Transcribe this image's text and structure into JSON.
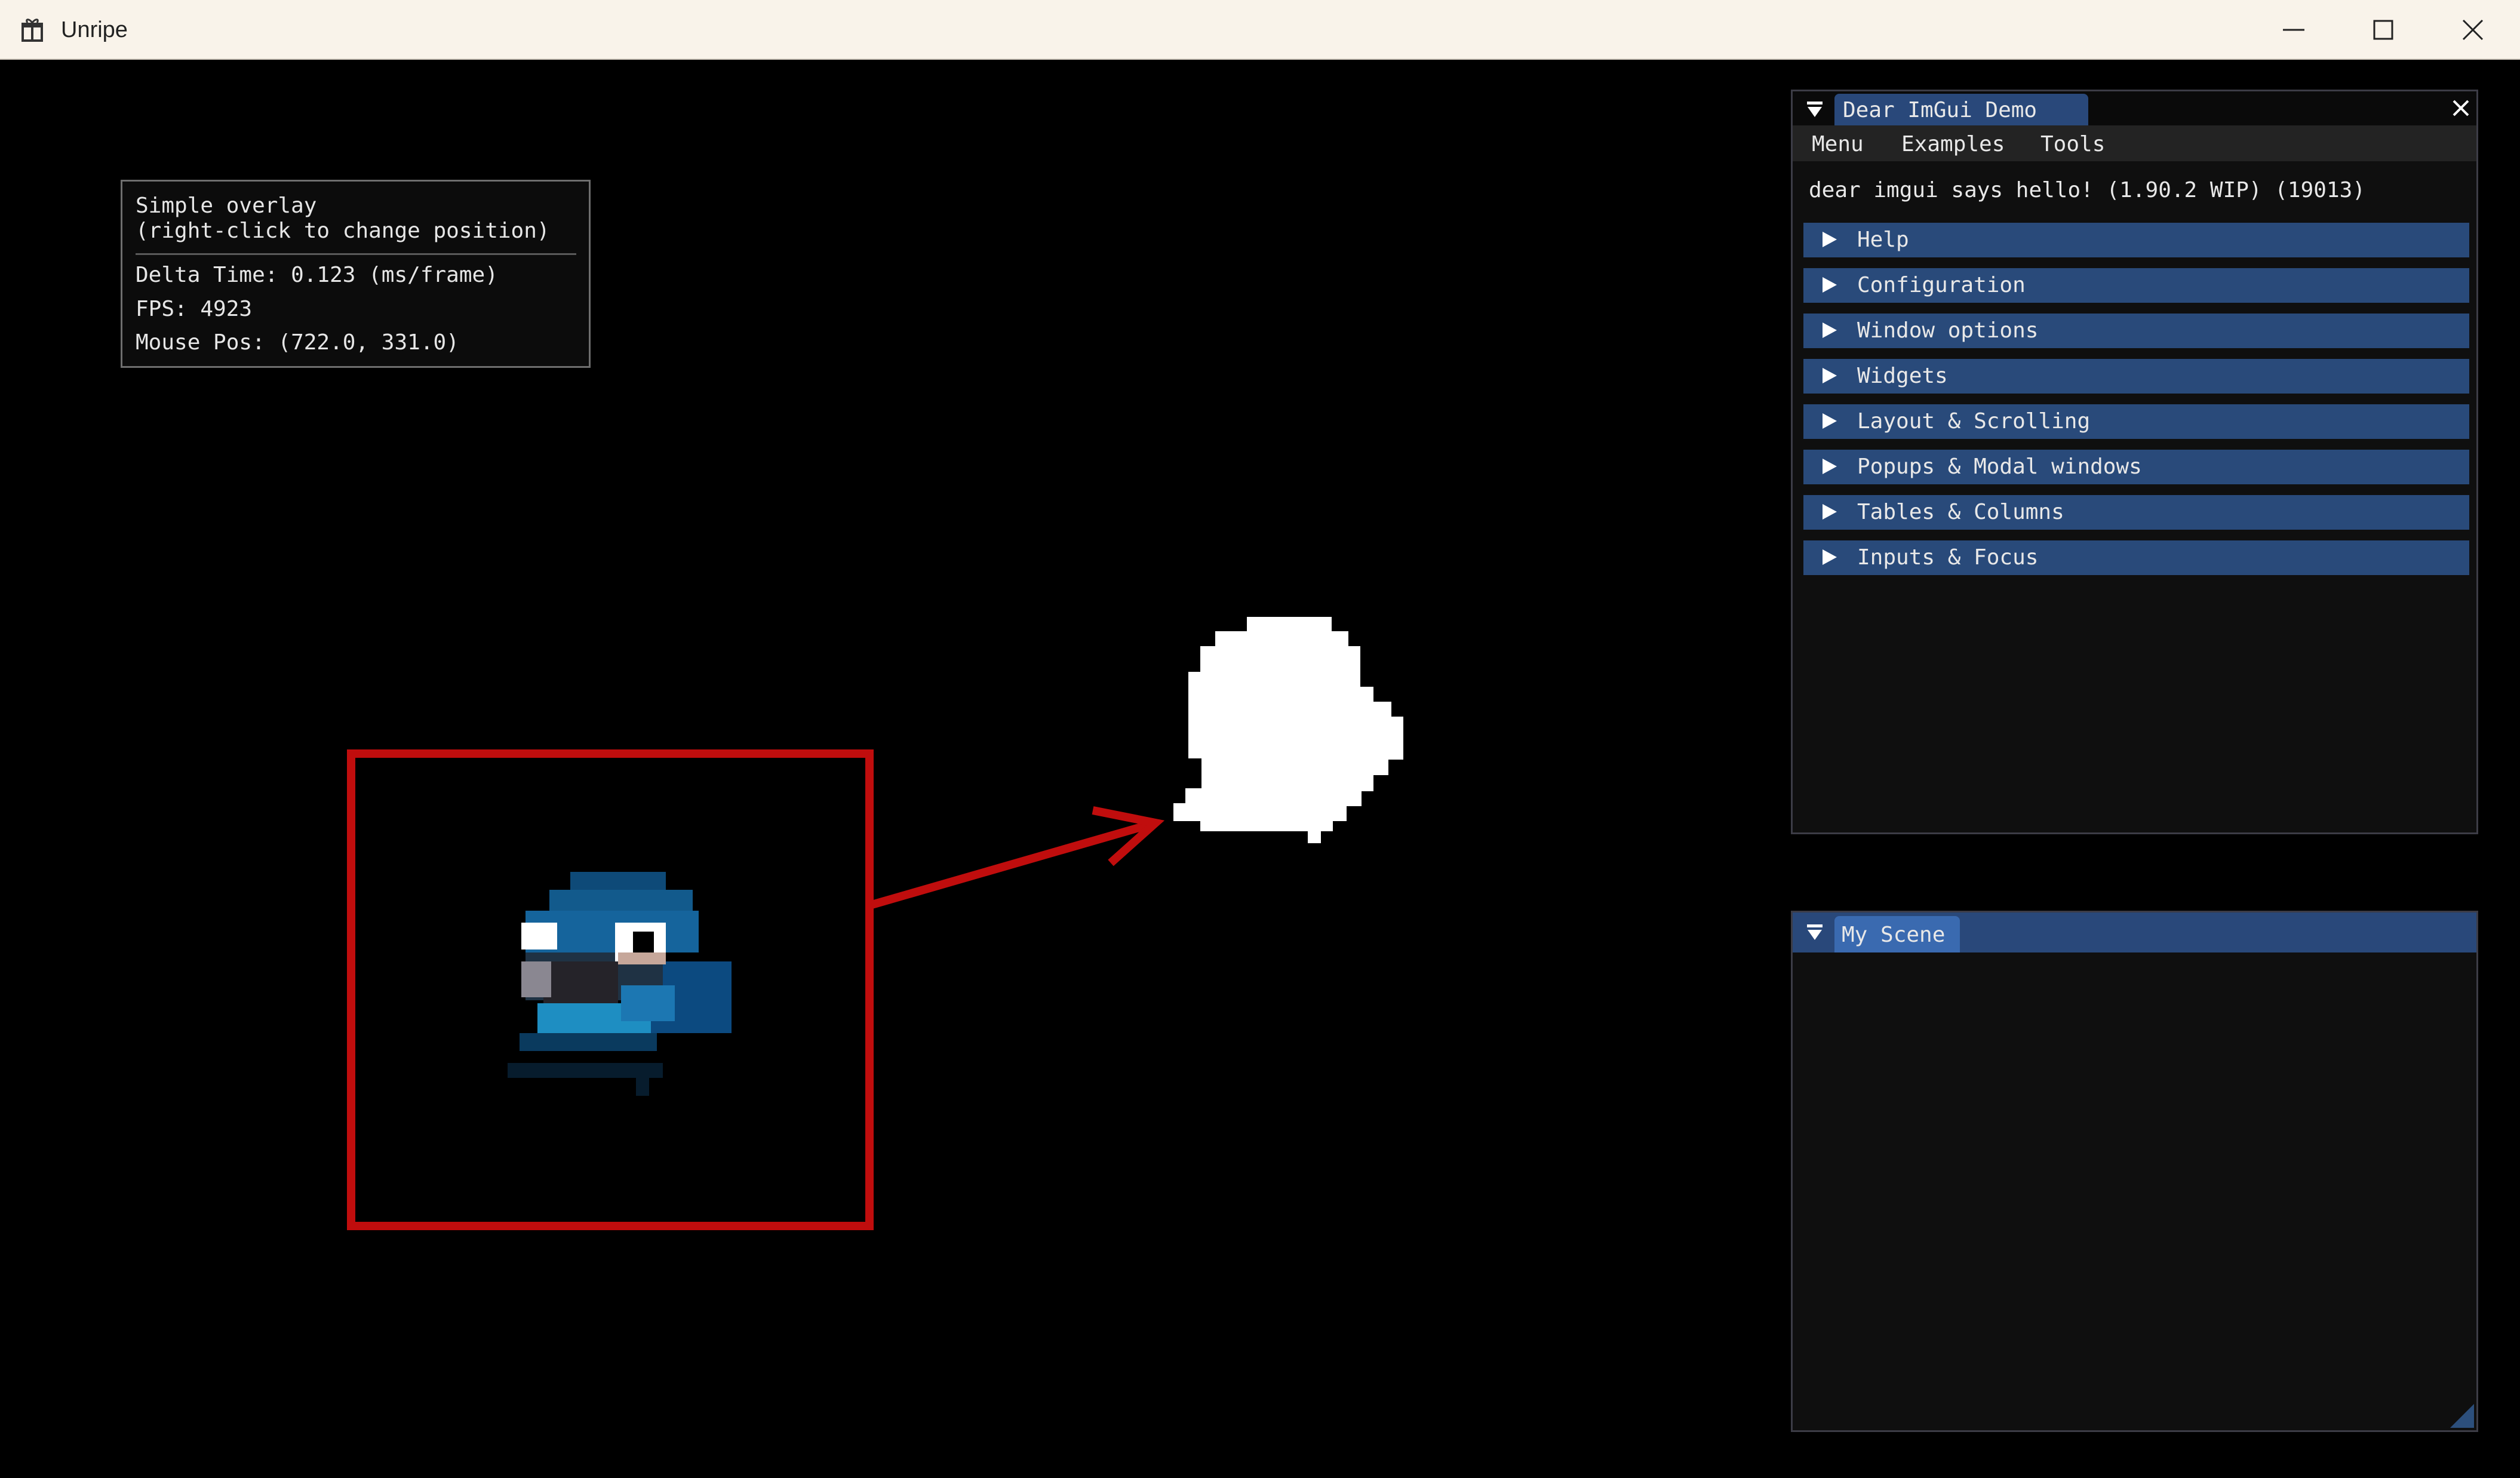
{
  "window": {
    "title": "Unripe",
    "app_icon": "gift-icon",
    "controls": [
      "minimize-icon",
      "maximize-icon",
      "close-icon"
    ]
  },
  "overlay": {
    "title": "Simple overlay",
    "hint": "(right-click to change position)",
    "delta_time": "Delta Time: 0.123 (ms/frame)",
    "fps": "FPS: 4923",
    "mouse_pos": "Mouse Pos: (722.0, 331.0)"
  },
  "demo_window": {
    "tab_title": "Dear ImGui Demo",
    "menu": [
      "Menu",
      "Examples",
      "Tools"
    ],
    "hello_text": "dear imgui says hello! (1.90.2 WIP) (19013)",
    "headers": [
      "Help",
      "Configuration",
      "Window options",
      "Widgets",
      "Layout & Scrolling",
      "Popups & Modal windows",
      "Tables & Columns",
      "Inputs & Focus"
    ]
  },
  "scene_window": {
    "tab_title": "My Scene"
  },
  "colors": {
    "background": "#000000",
    "titlebar": "#f9f3ea",
    "imgui_header": "#294a7a",
    "imgui_tab": "#29487a",
    "red_frame": "#c00d0d",
    "bird_blue": "#1f6fa8"
  }
}
